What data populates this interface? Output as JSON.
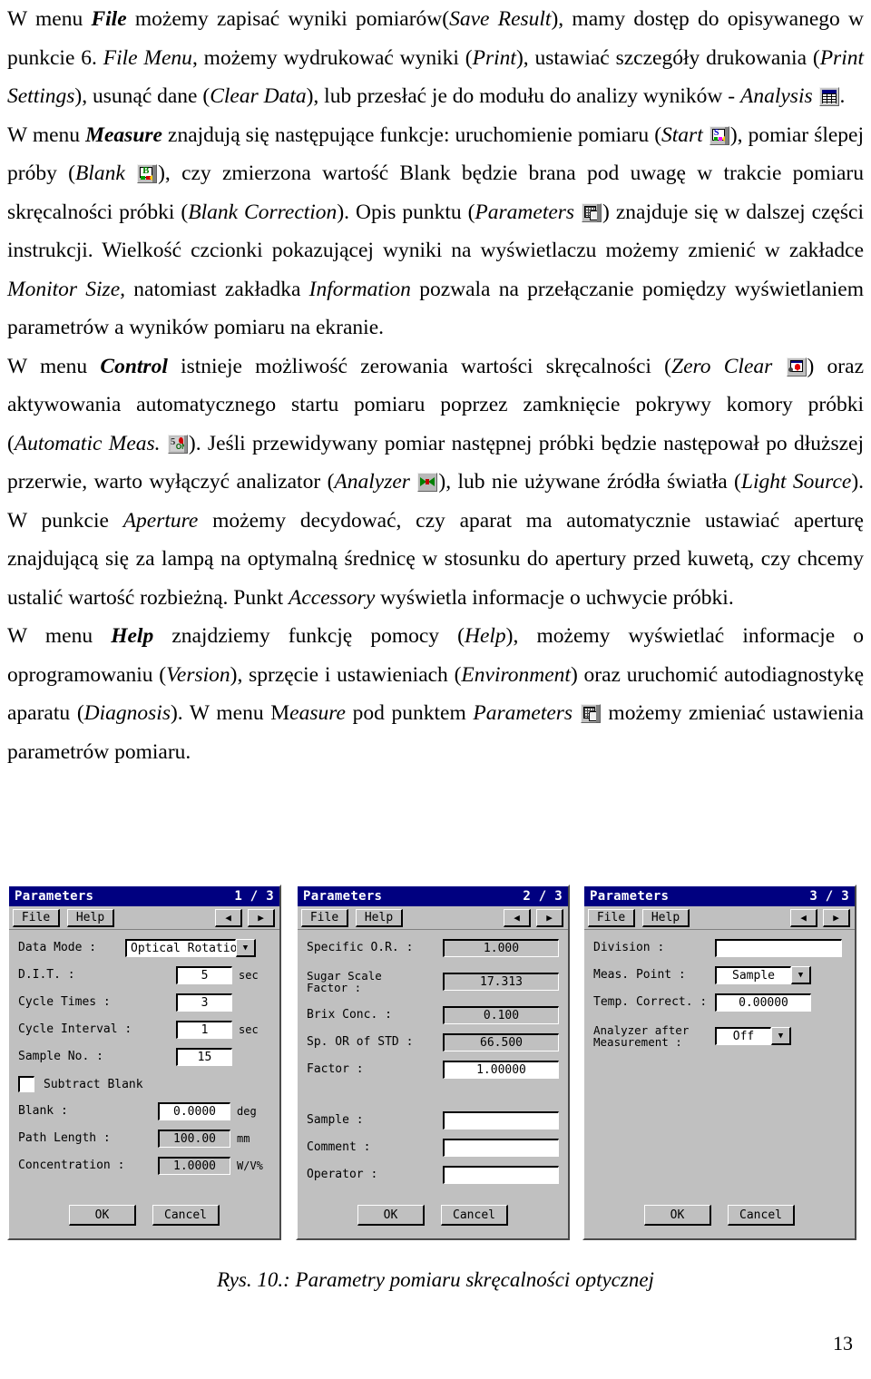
{
  "document": {
    "page_number": "13",
    "caption": "Rys. 10.: Parametry pomiaru skręcalności optycznej",
    "paragraphs": {
      "p1_a": "W menu ",
      "p1_file": "File",
      "p1_b": " możemy zapisać wyniki pomiarów(",
      "p1_save": "Save Result",
      "p1_c": "), mamy dostęp do opisywanego w punkcie 6. ",
      "p1_filemenu": "File Menu",
      "p1_d": ", możemy wydrukować wyniki (",
      "p1_print": "Print",
      "p1_e": "), ustawiać szczegóły drukowania (",
      "p1_printsettings": "Print Settings",
      "p1_f": "), usunąć dane (",
      "p1_cleardata": "Clear Data",
      "p1_g": "), lub przesłać je do modułu do analizy wyników - ",
      "p1_analysis": "Analysis",
      "p1_h": ".",
      "p2_a": "W menu ",
      "p2_measure": "Measure",
      "p2_b": " znajdują się  następujące funkcje: uruchomienie pomiaru (",
      "p2_start": "Start",
      "p2_c": "), pomiar ślepej próby (",
      "p2_blank": "Blank",
      "p2_d": "), czy zmierzona wartość Blank będzie brana pod uwagę w trakcie pomiaru skręcalności próbki (",
      "p2_blankcorr": "Blank Correction",
      "p2_e": "). Opis punktu (",
      "p2_parameters": "Parameters",
      "p2_f": ") znajduje się w dalszej części instrukcji. Wielkość czcionki pokazującej wyniki na wyświetlaczu możemy zmienić w zakładce ",
      "p2_monitorsize": "Monitor Size,",
      "p2_g": " natomiast zakładka ",
      "p2_information": "Information",
      "p2_h": " pozwala na przełączanie pomiędzy wyświetlaniem parametrów a wyników pomiaru na ekranie.",
      "p3_a": "W menu ",
      "p3_control": "Control",
      "p3_b": " istnieje możliwość zerowania wartości skręcalności (",
      "p3_zeroclear": "Zero Clear",
      "p3_c": ") oraz aktywowania automatycznego startu pomiaru poprzez zamknięcie pokrywy komory próbki (",
      "p3_automatic": "Automatic Meas.",
      "p3_d": "). Jeśli przewidywany pomiar następnej próbki będzie następował po dłuższej przerwie, warto wyłączyć analizator (",
      "p3_analyzer": "Analyzer",
      "p3_e": "), lub nie używane źródła światła (",
      "p3_lightsource": "Light Source",
      "p3_f": "). W punkcie ",
      "p3_aperture": "Aperture",
      "p3_g": " możemy decydować, czy aparat ma automatycznie ustawiać aperturę znajdującą się za lampą na optymalną średnicę w stosunku do apertury przed kuwetą, czy chcemy ustalić wartość rozbieżną. Punkt ",
      "p3_accessory": "Accessory",
      "p3_h": " wyświetla informacje o uchwycie próbki.",
      "p4_a": "W menu ",
      "p4_help": "Help",
      "p4_b": " znajdziemy funkcję pomocy (",
      "p4_helpitem": "Help",
      "p4_c": "), możemy wyświetlać informacje o oprogramowaniu (",
      "p4_version": "Version",
      "p4_d": "), sprzęcie i ustawieniach (",
      "p4_environment": "Environment",
      "p4_e": ") oraz uruchomić autodiagnostykę  aparatu (",
      "p4_diagnosis": "Diagnosis",
      "p4_f": "). W menu M",
      "p4_easure": "easure",
      "p4_g": " pod punktem ",
      "p4_parameters": "Parameters",
      "p4_h": " możemy zmieniać ustawienia parametrów pomiaru."
    },
    "icons": {
      "analysis": "analysis-spreadsheet-icon",
      "start": "start-measurement-icon",
      "blank": "blank-measurement-icon",
      "parameters": "parameters-icon",
      "zero_clear": "zero-clear-icon",
      "automatic_meas": "automatic-measurement-icon",
      "analyzer": "analyzer-icon"
    }
  },
  "dialogs": [
    {
      "title": "Parameters",
      "page_indicator": "1 / 3",
      "menu": [
        "File",
        "Help"
      ],
      "nav": {
        "prev": "◀",
        "next": "▶"
      },
      "fields": [
        {
          "label": "Data Mode :",
          "value": "Optical Rotation",
          "type": "combo",
          "unit": ""
        },
        {
          "label": "D.I.T. :",
          "value": "5",
          "type": "text",
          "unit": "sec"
        },
        {
          "label": "Cycle Times :",
          "value": "3",
          "type": "text",
          "unit": ""
        },
        {
          "label": "Cycle Interval :",
          "value": "1",
          "type": "text",
          "unit": "sec"
        },
        {
          "label": "Sample No. :",
          "value": "15",
          "type": "text",
          "unit": ""
        },
        {
          "label": "Subtract Blank",
          "value": "",
          "type": "checkbox",
          "unit": "",
          "checked": false
        },
        {
          "label": "Blank :",
          "value": "0.0000",
          "type": "text",
          "unit": "deg"
        },
        {
          "label": "Path Length :",
          "value": "100.00",
          "type": "readonly",
          "unit": "mm"
        },
        {
          "label": "Concentration :",
          "value": "1.0000",
          "type": "readonly",
          "unit": "W/V%"
        }
      ],
      "buttons": {
        "ok": "OK",
        "cancel": "Cancel"
      }
    },
    {
      "title": "Parameters",
      "page_indicator": "2 / 3",
      "menu": [
        "File",
        "Help"
      ],
      "nav": {
        "prev": "◀",
        "next": "▶"
      },
      "fields": [
        {
          "label": "Specific O.R. :",
          "value": "1.000",
          "type": "readonly",
          "unit": ""
        },
        {
          "label": "Sugar Scale\nFactor :",
          "value": "17.313",
          "type": "readonly",
          "unit": ""
        },
        {
          "label": "Brix Conc. :",
          "value": "0.100",
          "type": "readonly",
          "unit": ""
        },
        {
          "label": "Sp. OR of STD :",
          "value": "66.500",
          "type": "readonly",
          "unit": ""
        },
        {
          "label": "Factor :",
          "value": "1.00000",
          "type": "text",
          "unit": ""
        },
        {
          "label": "Sample :",
          "value": "",
          "type": "text",
          "unit": ""
        },
        {
          "label": "Comment :",
          "value": "",
          "type": "text",
          "unit": ""
        },
        {
          "label": "Operator :",
          "value": "",
          "type": "text",
          "unit": ""
        }
      ],
      "buttons": {
        "ok": "OK",
        "cancel": "Cancel"
      }
    },
    {
      "title": "Parameters",
      "page_indicator": "3 / 3",
      "menu": [
        "File",
        "Help"
      ],
      "nav": {
        "prev": "◀",
        "next": "▶"
      },
      "fields": [
        {
          "label": "Division :",
          "value": "",
          "type": "text",
          "unit": ""
        },
        {
          "label": "Meas. Point :",
          "value": "Sample",
          "type": "combo",
          "unit": ""
        },
        {
          "label": "Temp. Correct. :",
          "value": "0.00000",
          "type": "text",
          "unit": ""
        },
        {
          "label": "Analyzer after\nMeasurement :",
          "value": "Off",
          "type": "combo",
          "unit": ""
        }
      ],
      "buttons": {
        "ok": "OK",
        "cancel": "Cancel"
      }
    }
  ],
  "colors": {
    "titlebar": "#000080",
    "dialog_face": "#c0c0c0",
    "field_bg": "#ffffff",
    "text": "#000000"
  }
}
